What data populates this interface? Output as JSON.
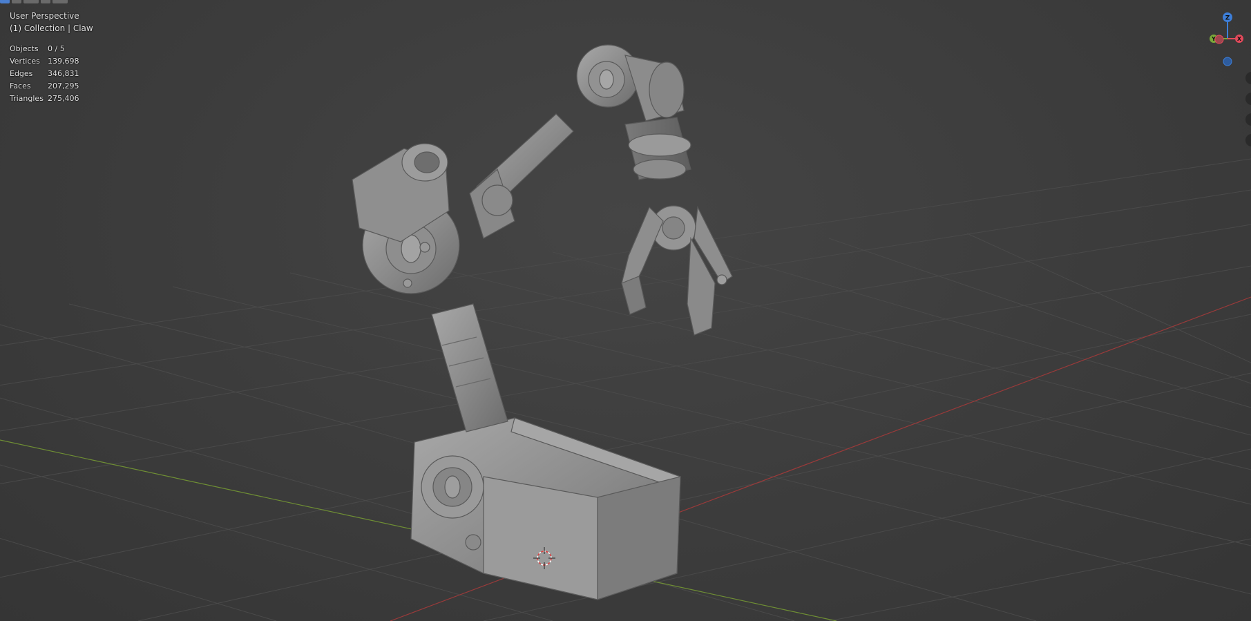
{
  "viewport": {
    "view_name": "User Perspective",
    "collection_label": "(1) Collection | Claw"
  },
  "stats": [
    {
      "label": "Objects",
      "value": "0 / 5"
    },
    {
      "label": "Vertices",
      "value": "139,698"
    },
    {
      "label": "Edges",
      "value": "346,831"
    },
    {
      "label": "Faces",
      "value": "207,295"
    },
    {
      "label": "Triangles",
      "value": "275,406"
    }
  ],
  "gizmo": {
    "z_label": "Z",
    "x_label": "X",
    "y_label": "Y",
    "colors": {
      "x": "#e34a5b",
      "y": "#7aa83a",
      "z": "#3d7ed8"
    }
  },
  "colors": {
    "background": "#3d3d3d",
    "grid": "#4a4a4a",
    "x_axis": "#9a3a3a",
    "y_axis": "#6f8f34",
    "model": "#8f8f8f"
  }
}
